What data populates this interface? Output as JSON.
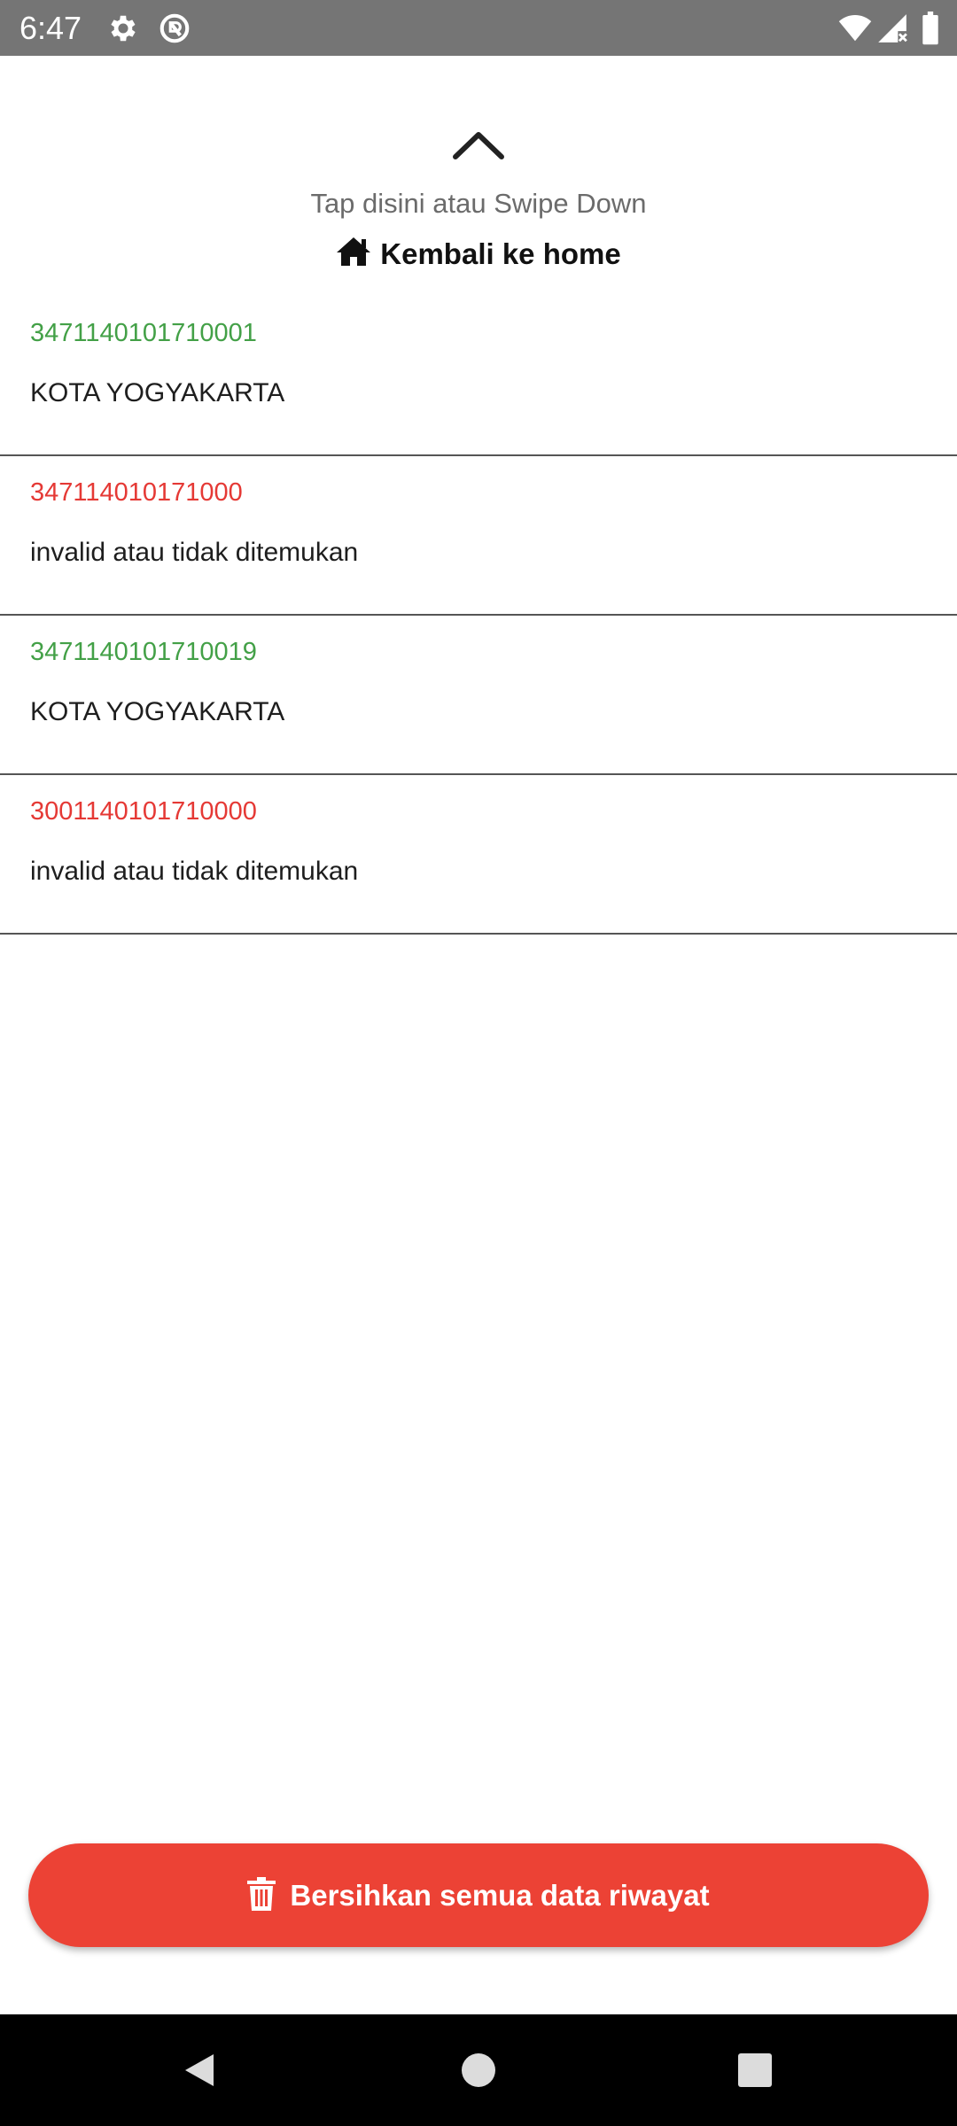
{
  "status_bar": {
    "time": "6:47",
    "icons": [
      "settings-icon",
      "sync-off-icon",
      "wifi-icon",
      "signal-icon",
      "battery-icon"
    ],
    "background": "#757575"
  },
  "header": {
    "hint": "Tap disini atau Swipe Down",
    "home_label": "Kembali ke home",
    "chevron_icon": "chevron-up-icon",
    "home_icon": "home-icon"
  },
  "history": [
    {
      "nik": "3471140101710001",
      "desc": "KOTA YOGYAKARTA",
      "valid": true
    },
    {
      "nik": "347114010171000",
      "desc": "invalid atau tidak ditemukan",
      "valid": false
    },
    {
      "nik": "3471140101710019",
      "desc": "KOTA YOGYAKARTA",
      "valid": true
    },
    {
      "nik": "3001140101710000",
      "desc": "invalid atau tidak ditemukan",
      "valid": false
    }
  ],
  "colors": {
    "valid": "#43a047",
    "invalid": "#e53935",
    "button": "#ec4235"
  },
  "clear_button": {
    "label": "Bersihkan semua data riwayat",
    "icon": "trash-icon"
  },
  "nav_bar": {
    "buttons": [
      "back-icon",
      "home-circle-icon",
      "recents-icon"
    ]
  }
}
